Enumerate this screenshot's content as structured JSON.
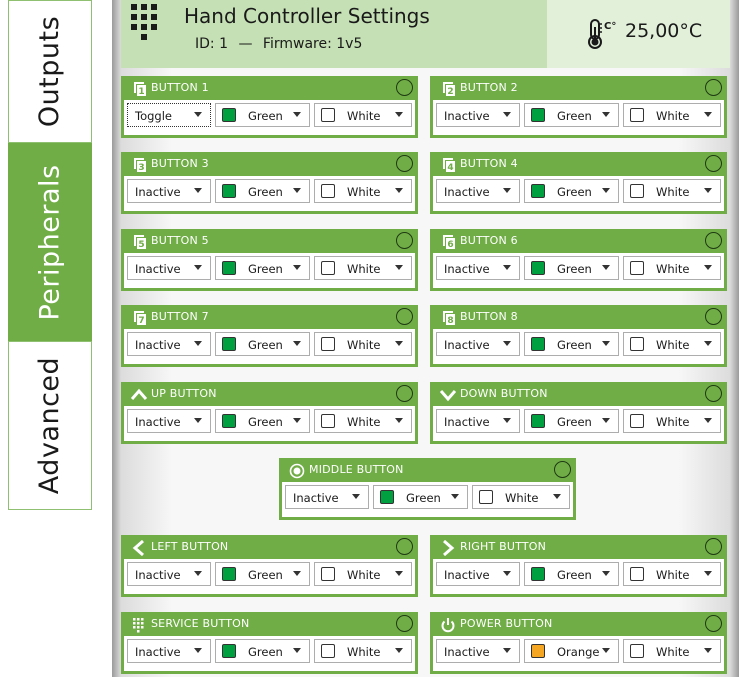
{
  "tabs": {
    "outputs": "Outputs",
    "peripherals": "Peripherals",
    "advanced": "Advanced"
  },
  "header": {
    "title": "Hand Controller Settings",
    "id_label": "ID:",
    "id_value": "1",
    "separator": "—",
    "firmware_label": "Firmware:",
    "firmware_value": "1v5",
    "temperature": "25,00°C"
  },
  "colors": {
    "accent": "#70ad47",
    "header_bg": "#c5e0b4",
    "green_swatch": "#00a040",
    "orange_swatch": "#f5a623",
    "white_swatch": "#ffffff"
  },
  "buttons": [
    {
      "title": "BUTTON 1",
      "icon": "numbered-button-1-icon",
      "mode": "Toggle",
      "color_on": "Green",
      "color_off": "White"
    },
    {
      "title": "BUTTON 2",
      "icon": "numbered-button-2-icon",
      "mode": "Inactive",
      "color_on": "Green",
      "color_off": "White"
    },
    {
      "title": "BUTTON 3",
      "icon": "numbered-button-3-icon",
      "mode": "Inactive",
      "color_on": "Green",
      "color_off": "White"
    },
    {
      "title": "BUTTON 4",
      "icon": "numbered-button-4-icon",
      "mode": "Inactive",
      "color_on": "Green",
      "color_off": "White"
    },
    {
      "title": "BUTTON 5",
      "icon": "numbered-button-5-icon",
      "mode": "Inactive",
      "color_on": "Green",
      "color_off": "White"
    },
    {
      "title": "BUTTON 6",
      "icon": "numbered-button-6-icon",
      "mode": "Inactive",
      "color_on": "Green",
      "color_off": "White"
    },
    {
      "title": "BUTTON 7",
      "icon": "numbered-button-7-icon",
      "mode": "Inactive",
      "color_on": "Green",
      "color_off": "White"
    },
    {
      "title": "BUTTON 8",
      "icon": "numbered-button-8-icon",
      "mode": "Inactive",
      "color_on": "Green",
      "color_off": "White"
    },
    {
      "title": "UP BUTTON",
      "icon": "chevron-up-icon",
      "mode": "Inactive",
      "color_on": "Green",
      "color_off": "White"
    },
    {
      "title": "DOWN BUTTON",
      "icon": "chevron-down-icon",
      "mode": "Inactive",
      "color_on": "Green",
      "color_off": "White"
    },
    {
      "title": "MIDDLE BUTTON",
      "icon": "radio-dot-icon",
      "mode": "Inactive",
      "color_on": "Green",
      "color_off": "White"
    },
    {
      "title": "LEFT BUTTON",
      "icon": "chevron-left-icon",
      "mode": "Inactive",
      "color_on": "Green",
      "color_off": "White"
    },
    {
      "title": "RIGHT BUTTON",
      "icon": "chevron-right-icon",
      "mode": "Inactive",
      "color_on": "Green",
      "color_off": "White"
    },
    {
      "title": "SERVICE BUTTON",
      "icon": "keypad-grid-icon",
      "mode": "Inactive",
      "color_on": "Green",
      "color_off": "White"
    },
    {
      "title": "POWER BUTTON",
      "icon": "power-icon",
      "mode": "Inactive",
      "color_on": "Orange",
      "color_off": "White"
    }
  ]
}
